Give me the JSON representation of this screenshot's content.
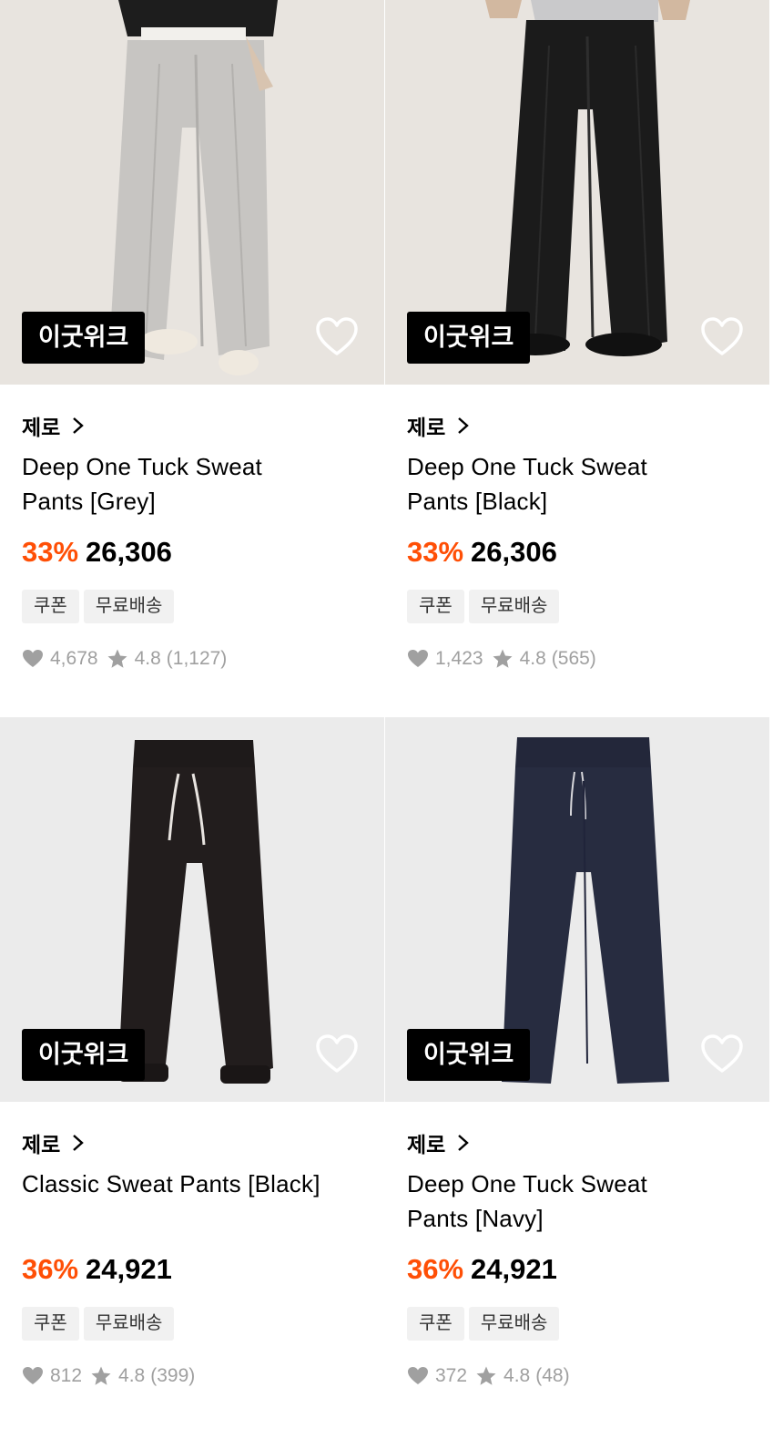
{
  "colors": {
    "discount": "#ff4f06",
    "badge_bg": "#000000",
    "tag_bg": "#f1f1f1",
    "meta_text": "#a0a0a0"
  },
  "products": [
    {
      "badge": "이굿위크",
      "brand": "제로",
      "title": "Deep One Tuck Sweat Pants [Grey]",
      "discount": "33%",
      "price": "26,306",
      "tags": [
        "쿠폰",
        "무료배송"
      ],
      "likes": "4,678",
      "rating": "4.8",
      "reviews": "(1,127)"
    },
    {
      "badge": "이굿위크",
      "brand": "제로",
      "title": "Deep One Tuck Sweat Pants [Black]",
      "discount": "33%",
      "price": "26,306",
      "tags": [
        "쿠폰",
        "무료배송"
      ],
      "likes": "1,423",
      "rating": "4.8",
      "reviews": "(565)"
    },
    {
      "badge": "이굿위크",
      "brand": "제로",
      "title": "Classic Sweat Pants [Black]",
      "discount": "36%",
      "price": "24,921",
      "tags": [
        "쿠폰",
        "무료배송"
      ],
      "likes": "812",
      "rating": "4.8",
      "reviews": "(399)"
    },
    {
      "badge": "이굿위크",
      "brand": "제로",
      "title": "Deep One Tuck Sweat Pants [Navy]",
      "discount": "36%",
      "price": "24,921",
      "tags": [
        "쿠폰",
        "무료배송"
      ],
      "likes": "372",
      "rating": "4.8",
      "reviews": "(48)"
    }
  ]
}
